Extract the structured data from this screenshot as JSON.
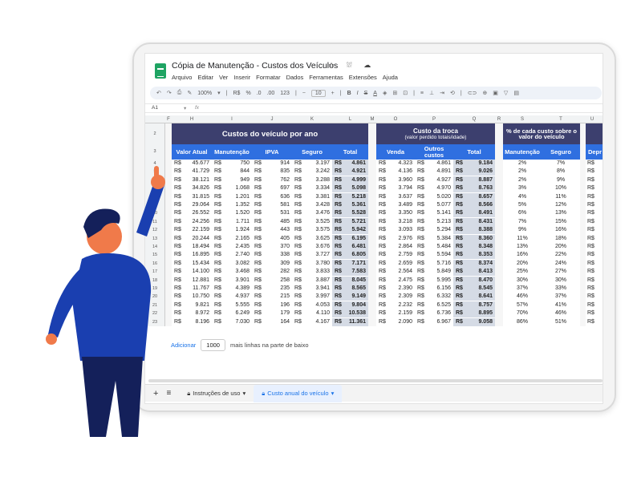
{
  "app": {
    "title": "Cópia de Manutenção - Custos dos Veículos",
    "menu": [
      "Arquivo",
      "Editar",
      "Ver",
      "Inserir",
      "Formatar",
      "Dados",
      "Ferramentas",
      "Extensões",
      "Ajuda"
    ]
  },
  "toolbar": {
    "zoom": "100%",
    "currency": "R$",
    "percent": "%",
    ".0": ".0",
    ".00": ".00",
    "123": "123",
    "font_size": "10"
  },
  "formula_bar": {
    "cell_ref": "A1",
    "fx": "fx"
  },
  "columns": [
    "F",
    "H",
    "I",
    "J",
    "K",
    "L",
    "M",
    "O",
    "P",
    "Q",
    "R",
    "S",
    "T",
    "U"
  ],
  "row_numbers": [
    "2",
    "3",
    "4",
    "5",
    "6",
    "7",
    "8",
    "9",
    "10",
    "11",
    "12",
    "13",
    "14",
    "15",
    "16",
    "17",
    "18",
    "19",
    "20",
    "21",
    "22",
    "23"
  ],
  "sections": {
    "custos": {
      "title": "Custos do veículo por ano",
      "headers": [
        "Valor Atual",
        "Manutenção",
        "IPVA",
        "Seguro",
        "Total"
      ]
    },
    "troca": {
      "title": "Custo da troca",
      "subtitle": "(valor perdido totais/idade)",
      "headers": [
        "Venda",
        "Outros custos",
        "Total"
      ]
    },
    "pct": {
      "title": "% de cada custo sobre o valor do veículo",
      "headers": [
        "Manutenção",
        "Seguro"
      ]
    },
    "depr": {
      "header": "Depr"
    }
  },
  "rows": [
    [
      "45.677",
      "750",
      "914",
      "3.197",
      "4.861",
      "4.323",
      "4.861",
      "9.184",
      "2%",
      "7%"
    ],
    [
      "41.729",
      "844",
      "835",
      "3.242",
      "4.921",
      "4.136",
      "4.891",
      "9.026",
      "2%",
      "8%"
    ],
    [
      "38.121",
      "949",
      "762",
      "3.288",
      "4.999",
      "3.960",
      "4.927",
      "8.887",
      "2%",
      "9%"
    ],
    [
      "34.826",
      "1.068",
      "697",
      "3.334",
      "5.098",
      "3.794",
      "4.970",
      "8.763",
      "3%",
      "10%"
    ],
    [
      "31.815",
      "1.201",
      "636",
      "3.381",
      "5.218",
      "3.637",
      "5.020",
      "8.657",
      "4%",
      "11%"
    ],
    [
      "29.064",
      "1.352",
      "581",
      "3.428",
      "5.361",
      "3.489",
      "5.077",
      "8.566",
      "5%",
      "12%"
    ],
    [
      "26.552",
      "1.520",
      "531",
      "3.476",
      "5.528",
      "3.350",
      "5.141",
      "8.491",
      "6%",
      "13%"
    ],
    [
      "24.256",
      "1.711",
      "485",
      "3.525",
      "5.721",
      "3.218",
      "5.213",
      "8.431",
      "7%",
      "15%"
    ],
    [
      "22.159",
      "1.924",
      "443",
      "3.575",
      "5.942",
      "3.093",
      "5.294",
      "8.388",
      "9%",
      "16%"
    ],
    [
      "20.244",
      "2.165",
      "405",
      "3.625",
      "6.195",
      "2.976",
      "5.384",
      "8.360",
      "11%",
      "18%"
    ],
    [
      "18.494",
      "2.435",
      "370",
      "3.676",
      "6.481",
      "2.864",
      "5.484",
      "8.348",
      "13%",
      "20%"
    ],
    [
      "16.895",
      "2.740",
      "338",
      "3.727",
      "6.805",
      "2.759",
      "5.594",
      "8.353",
      "16%",
      "22%"
    ],
    [
      "15.434",
      "3.082",
      "309",
      "3.780",
      "7.171",
      "2.659",
      "5.716",
      "8.374",
      "20%",
      "24%"
    ],
    [
      "14.100",
      "3.468",
      "282",
      "3.833",
      "7.583",
      "2.564",
      "5.849",
      "8.413",
      "25%",
      "27%"
    ],
    [
      "12.881",
      "3.901",
      "258",
      "3.887",
      "8.045",
      "2.475",
      "5.995",
      "8.470",
      "30%",
      "30%"
    ],
    [
      "11.767",
      "4.389",
      "235",
      "3.941",
      "8.565",
      "2.390",
      "6.156",
      "8.545",
      "37%",
      "33%"
    ],
    [
      "10.750",
      "4.937",
      "215",
      "3.997",
      "9.149",
      "2.309",
      "6.332",
      "8.641",
      "46%",
      "37%"
    ],
    [
      "9.821",
      "5.555",
      "196",
      "4.053",
      "9.804",
      "2.232",
      "6.525",
      "8.757",
      "57%",
      "41%"
    ],
    [
      "8.972",
      "6.249",
      "179",
      "4.110",
      "10.538",
      "2.159",
      "6.736",
      "8.895",
      "70%",
      "46%"
    ],
    [
      "8.196",
      "7.030",
      "164",
      "4.167",
      "11.361",
      "2.090",
      "6.967",
      "9.058",
      "86%",
      "51%"
    ]
  ],
  "add_rows": {
    "button": "Adicionar",
    "qty": "1000",
    "label": "mais linhas na parte de baixo"
  },
  "tabs": [
    {
      "label": "Instruções de uso"
    },
    {
      "label": "Custo anual do veículo"
    }
  ],
  "colors": {
    "header_dark": "#3c3f6e",
    "header_blue": "#2f6fe0",
    "person_shirt": "#1a3fb0",
    "person_pants": "#14205a",
    "skin": "#f07a4a"
  }
}
